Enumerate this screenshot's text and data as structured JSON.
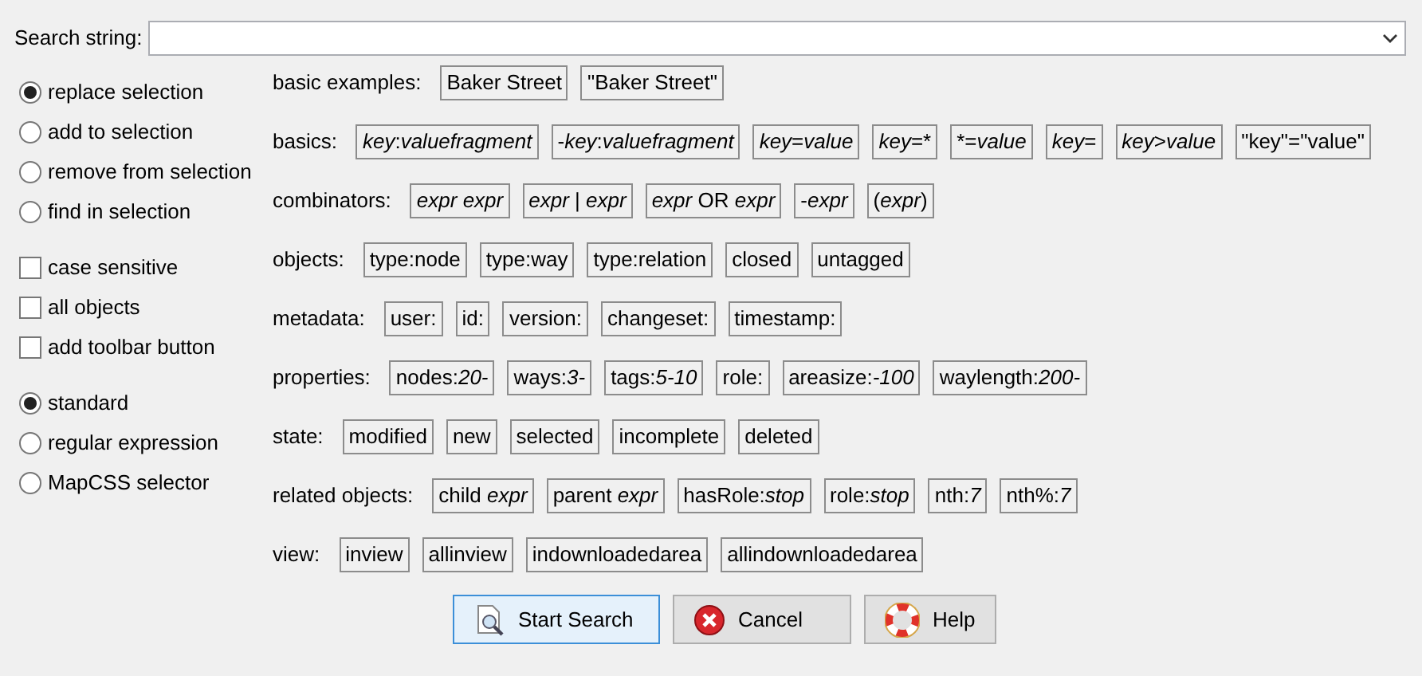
{
  "search": {
    "label": "Search string:"
  },
  "modes": [
    {
      "label": "replace selection",
      "selected": true
    },
    {
      "label": "add to selection",
      "selected": false
    },
    {
      "label": "remove from selection",
      "selected": false
    },
    {
      "label": "find in selection",
      "selected": false
    }
  ],
  "options": [
    {
      "label": "case sensitive",
      "checked": false
    },
    {
      "label": "all objects",
      "checked": false
    },
    {
      "label": "add toolbar button",
      "checked": false
    }
  ],
  "syntax": [
    {
      "label": "standard",
      "selected": true
    },
    {
      "label": "regular expression",
      "selected": false
    },
    {
      "label": "MapCSS selector",
      "selected": false
    }
  ],
  "groups": [
    {
      "label": "basic examples:",
      "chips": [
        [
          {
            "text": "Baker Street",
            "italic": false
          }
        ],
        [
          {
            "text": "\"Baker Street\"",
            "italic": false
          }
        ]
      ]
    },
    {
      "label": "basics:",
      "chips": [
        [
          {
            "text": "key",
            "italic": true
          },
          {
            "text": ":",
            "italic": false
          },
          {
            "text": "valuefragment",
            "italic": true
          }
        ],
        [
          {
            "text": "-",
            "italic": false
          },
          {
            "text": "key",
            "italic": true
          },
          {
            "text": ":",
            "italic": false
          },
          {
            "text": "valuefragment",
            "italic": true
          }
        ],
        [
          {
            "text": "key",
            "italic": true
          },
          {
            "text": "=",
            "italic": false
          },
          {
            "text": "value",
            "italic": true
          }
        ],
        [
          {
            "text": "key",
            "italic": true
          },
          {
            "text": "=*",
            "italic": false
          }
        ],
        [
          {
            "text": "*=",
            "italic": false
          },
          {
            "text": "value",
            "italic": true
          }
        ],
        [
          {
            "text": "key",
            "italic": true
          },
          {
            "text": "=",
            "italic": false
          }
        ],
        [
          {
            "text": "key",
            "italic": true
          },
          {
            "text": ">",
            "italic": false
          },
          {
            "text": "value",
            "italic": true
          }
        ],
        [
          {
            "text": "\"key\"=\"value\"",
            "italic": false
          }
        ]
      ]
    },
    {
      "label": "combinators:",
      "chips": [
        [
          {
            "text": "expr expr",
            "italic": true
          }
        ],
        [
          {
            "text": "expr",
            "italic": true
          },
          {
            "text": " | ",
            "italic": false
          },
          {
            "text": "expr",
            "italic": true
          }
        ],
        [
          {
            "text": "expr",
            "italic": true
          },
          {
            "text": " OR ",
            "italic": false
          },
          {
            "text": "expr",
            "italic": true
          }
        ],
        [
          {
            "text": "-",
            "italic": false
          },
          {
            "text": "expr",
            "italic": true
          }
        ],
        [
          {
            "text": "(",
            "italic": false
          },
          {
            "text": "expr",
            "italic": true
          },
          {
            "text": ")",
            "italic": false
          }
        ]
      ]
    },
    {
      "label": "objects:",
      "chips": [
        [
          {
            "text": "type:node",
            "italic": false
          }
        ],
        [
          {
            "text": "type:way",
            "italic": false
          }
        ],
        [
          {
            "text": "type:relation",
            "italic": false
          }
        ],
        [
          {
            "text": "closed",
            "italic": false
          }
        ],
        [
          {
            "text": "untagged",
            "italic": false
          }
        ]
      ]
    },
    {
      "label": "metadata:",
      "chips": [
        [
          {
            "text": "user:",
            "italic": false
          }
        ],
        [
          {
            "text": "id:",
            "italic": false
          }
        ],
        [
          {
            "text": "version:",
            "italic": false
          }
        ],
        [
          {
            "text": "changeset:",
            "italic": false
          }
        ],
        [
          {
            "text": "timestamp:",
            "italic": false
          }
        ]
      ]
    },
    {
      "label": "properties:",
      "chips": [
        [
          {
            "text": "nodes:",
            "italic": false
          },
          {
            "text": "20-",
            "italic": true
          }
        ],
        [
          {
            "text": "ways:",
            "italic": false
          },
          {
            "text": "3-",
            "italic": true
          }
        ],
        [
          {
            "text": "tags:",
            "italic": false
          },
          {
            "text": "5-10",
            "italic": true
          }
        ],
        [
          {
            "text": "role:",
            "italic": false
          }
        ],
        [
          {
            "text": "areasize:",
            "italic": false
          },
          {
            "text": "-100",
            "italic": true
          }
        ],
        [
          {
            "text": "waylength:",
            "italic": false
          },
          {
            "text": "200-",
            "italic": true
          }
        ]
      ]
    },
    {
      "label": "state:",
      "chips": [
        [
          {
            "text": "modified",
            "italic": false
          }
        ],
        [
          {
            "text": "new",
            "italic": false
          }
        ],
        [
          {
            "text": "selected",
            "italic": false
          }
        ],
        [
          {
            "text": "incomplete",
            "italic": false
          }
        ],
        [
          {
            "text": "deleted",
            "italic": false
          }
        ]
      ]
    },
    {
      "label": "related objects:",
      "chips": [
        [
          {
            "text": "child ",
            "italic": false
          },
          {
            "text": "expr",
            "italic": true
          }
        ],
        [
          {
            "text": "parent ",
            "italic": false
          },
          {
            "text": "expr",
            "italic": true
          }
        ],
        [
          {
            "text": "hasRole:",
            "italic": false
          },
          {
            "text": "stop",
            "italic": true
          }
        ],
        [
          {
            "text": "role:",
            "italic": false
          },
          {
            "text": "stop",
            "italic": true
          }
        ],
        [
          {
            "text": "nth:",
            "italic": false
          },
          {
            "text": "7",
            "italic": true
          }
        ],
        [
          {
            "text": "nth%:",
            "italic": false
          },
          {
            "text": "7",
            "italic": true
          }
        ]
      ]
    },
    {
      "label": "view:",
      "chips": [
        [
          {
            "text": "inview",
            "italic": false
          }
        ],
        [
          {
            "text": "allinview",
            "italic": false
          }
        ],
        [
          {
            "text": "indownloadedarea",
            "italic": false
          }
        ],
        [
          {
            "text": "allindownloadedarea",
            "italic": false
          }
        ]
      ]
    }
  ],
  "buttons": [
    {
      "label": "Start Search",
      "kind": "search",
      "focused": true
    },
    {
      "label": "Cancel",
      "kind": "cancel",
      "focused": false
    },
    {
      "label": "Help",
      "kind": "help",
      "focused": false
    }
  ]
}
